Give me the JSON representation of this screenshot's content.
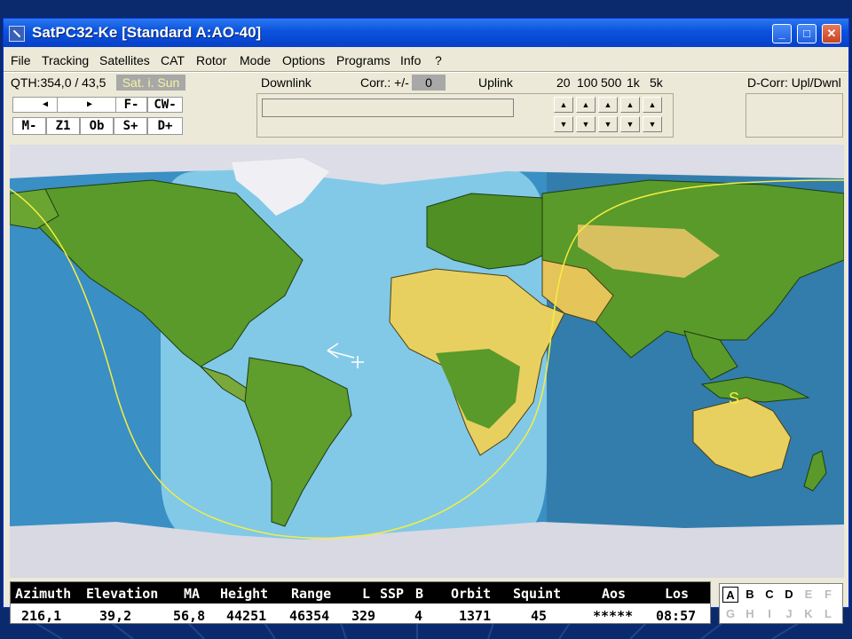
{
  "window": {
    "title": "SatPC32-Ke [Standard  A:AO-40]"
  },
  "menu": [
    "File",
    "Tracking",
    "Satellites",
    "CAT",
    "Rotor",
    "Mode",
    "Options",
    "Programs",
    "Info",
    "?"
  ],
  "toolbar": {
    "qth": "QTH:354,0 / 43,5",
    "sat_sun": "Sat. i. Sun",
    "downlink": "Downlink",
    "corr_label": "Corr.: +/-",
    "corr_value": "0",
    "uplink": "Uplink",
    "steps": [
      "20",
      "100",
      "500",
      "1k",
      "5k"
    ],
    "dcorr": "D-Corr: Upl/Dwnl",
    "buttons_row1": [
      "F-",
      "CW-"
    ],
    "buttons_row2": [
      "M-",
      "Z1",
      "Ob",
      "S+",
      "D+"
    ]
  },
  "map": {
    "sun_marker": "S"
  },
  "table": {
    "headers": [
      "Azimuth",
      "Elevation",
      "MA",
      "Height",
      "Range",
      "L",
      "SSP",
      "B",
      "Orbit",
      "Squint",
      "Aos",
      "Los"
    ],
    "values": [
      "216,1",
      "39,2",
      "56,8",
      "44251",
      "46354",
      "329",
      "4",
      "1371",
      "45",
      "*****",
      "08:57"
    ]
  },
  "letters": {
    "row1": [
      "A",
      "B",
      "C",
      "D",
      "E",
      "F"
    ],
    "row2": [
      "G",
      "H",
      "I",
      "J",
      "K",
      "L"
    ]
  },
  "colors": {
    "ocean": "#3a8fc4",
    "footprint": "#8fd3ee",
    "land": "#5a9a2a",
    "desert": "#e8d060",
    "header_bg": "#000000",
    "sat_sun_bg": "#a8a8a8"
  }
}
